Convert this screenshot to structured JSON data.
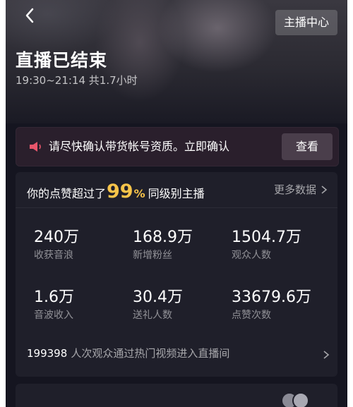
{
  "header": {
    "anchor_center_label": "主播中心",
    "title": "直播已结束",
    "time_range": "19:30~21:14 共1.7小时"
  },
  "notice": {
    "text": "请尽快确认带货帐号资质。立即确认",
    "button_label": "查看",
    "icon": "speaker-icon"
  },
  "summary": {
    "rank_prefix": "你的点赞超过了",
    "rank_percent": "99",
    "rank_percent_sign": "%",
    "rank_suffix": "同级别主播",
    "more_label": "更多数据",
    "stats": [
      {
        "value": "240万",
        "label": "收获音浪"
      },
      {
        "value": "168.9万",
        "label": "新增粉丝"
      },
      {
        "value": "1504.7万",
        "label": "观众人数"
      },
      {
        "value": "1.6万",
        "label": "音波收入"
      },
      {
        "value": "30.4万",
        "label": "送礼人数"
      },
      {
        "value": "33679.6万",
        "label": "点赞次数"
      }
    ],
    "footer_number": "199398",
    "footer_text": "人次观众通过热门视频进入直播间"
  },
  "colors": {
    "accent": "#f7c44a",
    "notice_icon": "#e8566b",
    "background": "#151520",
    "card": "#1f1f2a"
  }
}
